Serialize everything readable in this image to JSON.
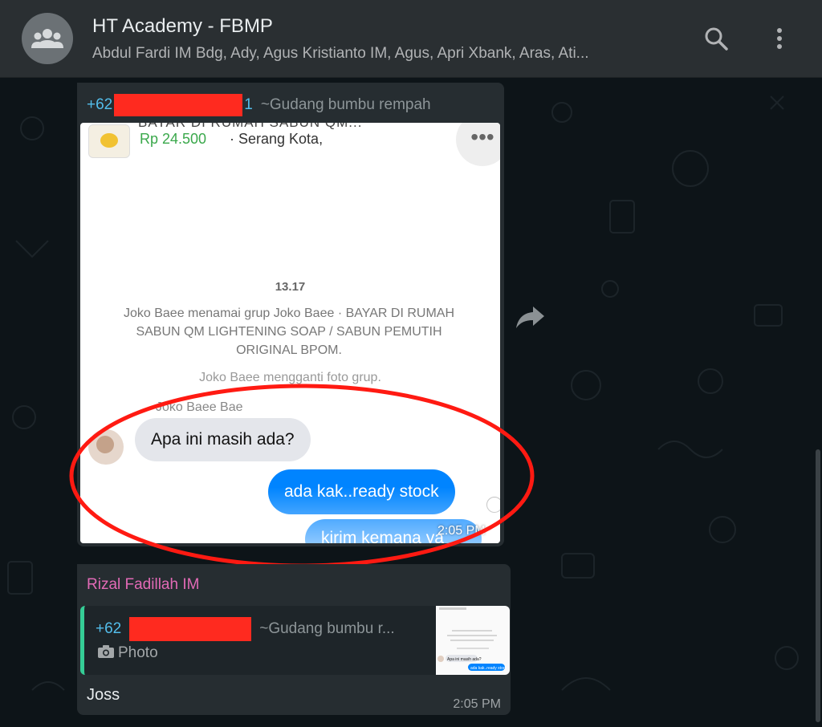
{
  "header": {
    "title": "HT Academy - FBMP",
    "subtitle": "Abdul Fardi IM Bdg, Ady, Agus Kristianto IM, Agus, Apri Xbank, Aras, Ati...",
    "icons": [
      "group-avatar-icon",
      "search-icon",
      "menu-icon"
    ]
  },
  "message1": {
    "sender_prefix": "+62",
    "sender_suffix": "1",
    "pushname": "~Gudang bumbu rempah",
    "screenshot": {
      "product_title_cut": "BAYAR DI RUMAH SABUN QM...",
      "price": "Rp 24.500",
      "location": "Serang Kota,",
      "time": "13.17",
      "system_line1": "Joko Baee menamai grup Joko Baee · BAYAR DI RUMAH SABUN QM LIGHTENING SOAP / SABUN PEMUTIH ORIGINAL BPOM.",
      "system_line2": "Joko Baee mengganti foto grup.",
      "sender": "Joko Baee Bae",
      "incoming": "Apa ini masih ada?",
      "outgoing1": "ada kak..ready stock",
      "outgoing2": "kirim kemana ya",
      "msg_time": "2:05 PM"
    },
    "annotation_color": "#ff1a12"
  },
  "message2": {
    "sender": "Rizal Fadillah IM",
    "quote_prefix": "+62",
    "quote_pushname": "~Gudang bumbu r...",
    "quote_type": "Photo",
    "text": "Joss",
    "time": "2:05 PM",
    "thumb": {
      "in": "Apa ini masih ada?",
      "out": "ada kak..ready stock"
    }
  }
}
